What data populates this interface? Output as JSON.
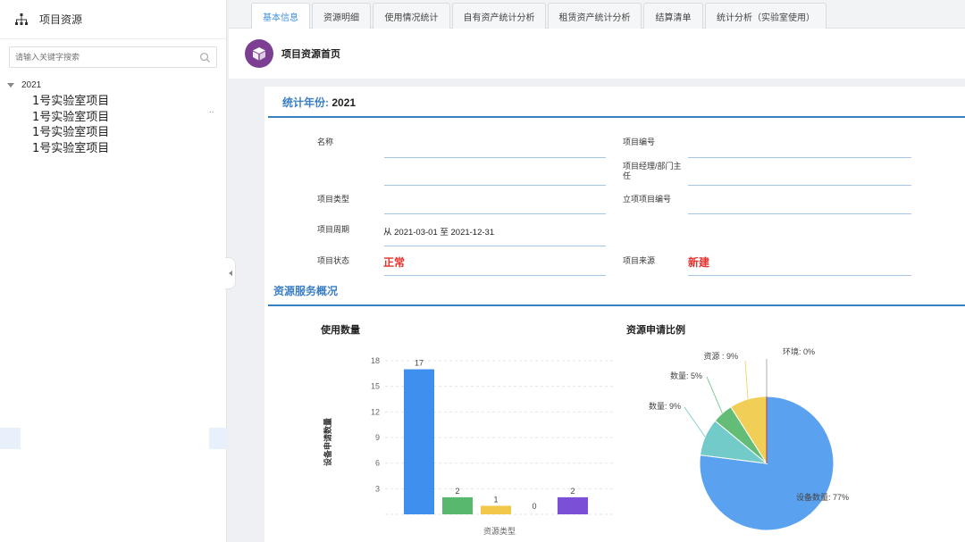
{
  "sidebar": {
    "title": "项目资源",
    "search_placeholder": "请输入关键字搜索",
    "tree": {
      "root_label": "2021",
      "children": [
        "1号实验室项目",
        "1号实验室项目",
        "1号实验室项目",
        "1号实验室项目"
      ],
      "more": ".."
    }
  },
  "tabs": [
    "基本信息",
    "资源明细",
    "使用情况统计",
    "自有资产统计分析",
    "租赁资产统计分析",
    "结算清单",
    "统计分析（实验室使用）"
  ],
  "header": {
    "title": "项目资源首页"
  },
  "summary": {
    "year_label": "统计年份:",
    "year": "2021",
    "fields": {
      "name_label": "名称",
      "code_label": "项目编号",
      "manager_label": "项目经理/部门主任",
      "type_label": "项目类型",
      "approval_label": "立项项目编号",
      "period_label": "项目周期",
      "period_value": "从 2021-03-01  至  2021-12-31",
      "status_label": "项目状态",
      "status_value": "正常",
      "source_label": "项目来源",
      "source_value": "新建"
    }
  },
  "overview": {
    "title": "资源服务概况"
  },
  "charts": {
    "usage_title": "使用数量",
    "ratio_title": "资源申请比例"
  },
  "colors": {
    "accent": "#3a7fc4",
    "status_red": "#e5322d",
    "purple_badge": "#7d3f92"
  },
  "chart_data": [
    {
      "type": "bar",
      "title": "使用数量",
      "xlabel": "资源类型",
      "ylabel": "设备申请数量",
      "ylim": [
        0,
        18
      ],
      "yticks": [
        3,
        6,
        9,
        12,
        15,
        18
      ],
      "values": [
        17,
        2,
        1,
        0,
        2
      ],
      "colors": [
        "#3f8fee",
        "#58b96e",
        "#f1c84a",
        "#8fa6c8",
        "#7b4fd6"
      ],
      "grid": true
    },
    {
      "type": "pie",
      "title": "资源申请比例",
      "labels": [
        "设备数量: 77%",
        "数量: 9%",
        "数量: 5%",
        "资源  : 9%",
        "环境: 0%"
      ],
      "values": [
        77,
        9,
        5,
        9,
        0
      ],
      "colors": [
        "#5aa2ef",
        "#72cbc9",
        "#64bd77",
        "#f1cf57",
        "#c0392b"
      ]
    }
  ]
}
